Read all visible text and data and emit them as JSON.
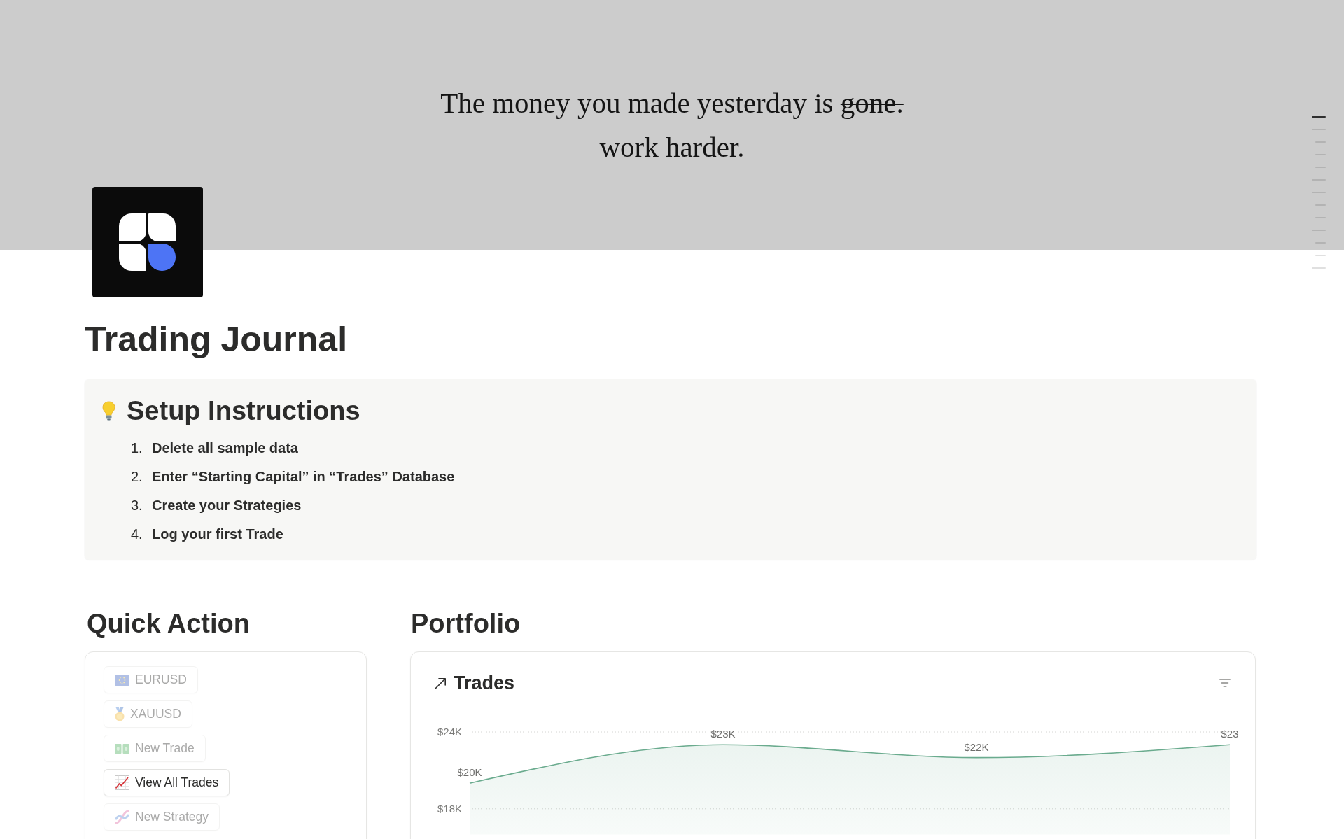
{
  "banner": {
    "lines": [
      {
        "segments": [
          {
            "text": "The money you made yesterday is",
            "struck": false
          },
          {
            "text": "gone.",
            "struck": true
          }
        ]
      },
      {
        "segments": [
          {
            "text": "work harder.",
            "struck": false
          }
        ]
      }
    ]
  },
  "outline_markers": [
    {
      "kind": "major",
      "selected": true
    },
    {
      "kind": "major",
      "selected": false
    },
    {
      "kind": "minor",
      "selected": false
    },
    {
      "kind": "minor",
      "selected": false
    },
    {
      "kind": "minor",
      "selected": false
    },
    {
      "kind": "major",
      "selected": false
    },
    {
      "kind": "major",
      "selected": false
    },
    {
      "kind": "minor",
      "selected": false
    },
    {
      "kind": "minor",
      "selected": false
    },
    {
      "kind": "major",
      "selected": false
    },
    {
      "kind": "minor",
      "selected": false
    },
    {
      "kind": "minor",
      "selected": false
    },
    {
      "kind": "major",
      "selected": false
    }
  ],
  "page": {
    "title": "Trading Journal"
  },
  "callout": {
    "heading": "Setup Instructions",
    "steps": [
      {
        "number": "1.",
        "text": "Delete all sample data"
      },
      {
        "number": "2.",
        "text": "Enter “Starting Capital” in “Trades” Database"
      },
      {
        "number": "3.",
        "text": "Create your Strategies"
      },
      {
        "number": "4.",
        "text": "Log your first Trade"
      }
    ]
  },
  "quick_action": {
    "heading": "Quick Action",
    "buttons": [
      {
        "label": "EURUSD",
        "disabled": true
      },
      {
        "label": "XAUUSD",
        "disabled": true
      },
      {
        "label": "New Trade",
        "disabled": true
      },
      {
        "label": "View All Trades",
        "disabled": false
      },
      {
        "label": "New Strategy",
        "disabled": true
      }
    ]
  },
  "portfolio": {
    "heading": "Portfolio",
    "view": {
      "title": "Trades"
    },
    "chart_data": {
      "type": "area",
      "categories": [
        null,
        null,
        null,
        null
      ],
      "series": [
        {
          "color": "#6aab8e",
          "values": [
            20000,
            23000,
            22000,
            23000
          ]
        }
      ],
      "ylim": [
        16000,
        24000
      ],
      "yticks": [
        {
          "value": 24000,
          "label": "$24K"
        },
        {
          "value": 18000,
          "label": "$18K"
        }
      ],
      "value_labels": [
        "$20K",
        "$23K",
        "$22K",
        "$23"
      ]
    }
  }
}
